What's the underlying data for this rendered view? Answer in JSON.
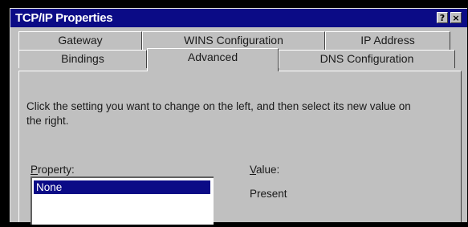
{
  "window": {
    "title": "TCP/IP Properties",
    "help_button": "?",
    "close_button": "×"
  },
  "tabs": {
    "row_back": [
      "Gateway",
      "WINS Configuration",
      "IP Address"
    ],
    "row_front": [
      "Bindings",
      "Advanced",
      "DNS Configuration"
    ],
    "active": "Advanced"
  },
  "advanced": {
    "instructions": "Click the setting you want to change on the left, and then select its new value on the right.",
    "property_label_accel": "P",
    "property_label_rest": "roperty:",
    "value_label_accel": "V",
    "value_label_rest": "alue:",
    "property_items": [
      "None"
    ],
    "selected_property": "None",
    "value": "Present"
  },
  "colors": {
    "titlebar": "#0b0b86",
    "face": "#c0c0c0",
    "selection": "#0b0b86"
  }
}
